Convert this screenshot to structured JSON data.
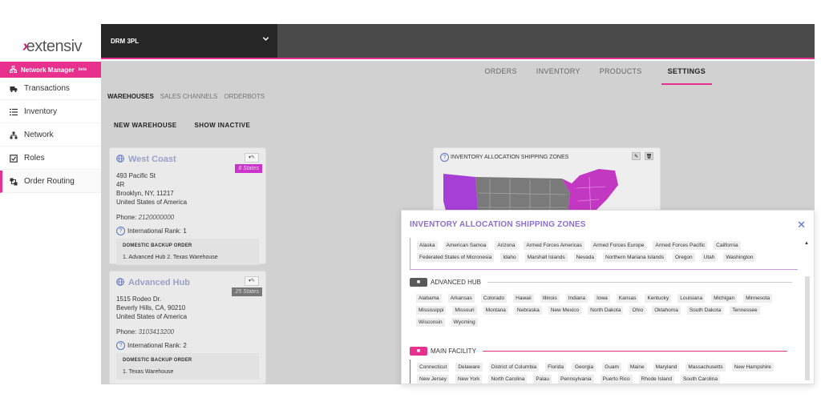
{
  "brand": {
    "mark": "›",
    "name": "extensiv"
  },
  "sidebar": {
    "header": "Network Manager",
    "header_badge": "beta",
    "items": [
      {
        "label": "Transactions",
        "icon": "truck-icon"
      },
      {
        "label": "Inventory",
        "icon": "list-icon"
      },
      {
        "label": "Network",
        "icon": "network-icon"
      },
      {
        "label": "Roles",
        "icon": "checkbox-icon"
      },
      {
        "label": "Order Routing",
        "icon": "routing-icon"
      }
    ]
  },
  "topbar": {
    "account": "DRM 3PL"
  },
  "tabs": [
    "ORDERS",
    "INVENTORY",
    "PRODUCTS",
    "SETTINGS"
  ],
  "active_tab": "SETTINGS",
  "subtabs": [
    "WAREHOUSES",
    "SALES CHANNELS",
    "ORDERBOTS"
  ],
  "active_subtab": "WAREHOUSES",
  "actions": {
    "new_warehouse": "NEW WAREHOUSE",
    "show_inactive": "SHOW INACTIVE"
  },
  "warehouses": [
    {
      "name": "West Coast",
      "badge": "8 States",
      "address1": "493 Pacific St",
      "address2": "4R",
      "city": "Brooklyn, NY, 11217",
      "country": "United States of America",
      "phone_label": "Phone:",
      "phone": "2120000000",
      "rank": "International Rank: 1",
      "backup_label": "DOMESTIC BACKUP ORDER",
      "backup": "1. Advanced Hub  2. Texas Warehouse"
    },
    {
      "name": "Advanced Hub",
      "badge": "25 States",
      "address1": "1515 Rodeo Dr.",
      "city": "Beverly Hills, CA, 90210",
      "country": "United States of America",
      "phone_label": "Phone:",
      "phone": "3103413200",
      "rank": "International Rank: 2",
      "backup_label": "DOMESTIC BACKUP ORDER",
      "backup": "1. Texas Warehouse"
    }
  ],
  "map_card": {
    "title": "INVENTORY ALLOCATION SHIPPING ZONES"
  },
  "modal": {
    "title": "INVENTORY ALLOCATION SHIPPING ZONES",
    "close": "✕",
    "first_group": [
      "Alaska",
      "American Samoa",
      "Arizona",
      "Armed Forces Americas",
      "Armed Forces Europe",
      "Armed Forces Pacific",
      "California",
      "Federated States of Micronesia",
      "Idaho",
      "Marshall Islands",
      "Nevada",
      "Northern Mariana Islands",
      "Oregon",
      "Utah",
      "Washington"
    ],
    "advanced_hub": {
      "label": "ADVANCED HUB",
      "states": [
        "Alabama",
        "Arkansas",
        "Colorado",
        "Hawaii",
        "Illinois",
        "Indiana",
        "Iowa",
        "Kansas",
        "Kentucky",
        "Louisiana",
        "Michigan",
        "Minnesota",
        "Mississippi",
        "Missouri",
        "Montana",
        "Nebraska",
        "New Mexico",
        "North Dakota",
        "Ohio",
        "Oklahoma",
        "South Dakota",
        "Tennessee",
        "Wisconsin",
        "Wyoming"
      ]
    },
    "main_facility": {
      "label": "MAIN FACILITY",
      "states": [
        "Connecticut",
        "Delaware",
        "District of Columbia",
        "Florida",
        "Georgia",
        "Guam",
        "Maine",
        "Maryland",
        "Massachusetts",
        "New Hampshire",
        "New Jersey",
        "New York",
        "North Carolina",
        "Palau",
        "Pennsylvania",
        "Puerto Rico",
        "Rhode Island",
        "South Carolina"
      ]
    }
  },
  "colors": {
    "accent": "#e8318f",
    "purple": "#a63fd6",
    "modal_title": "#8b6fd6"
  }
}
